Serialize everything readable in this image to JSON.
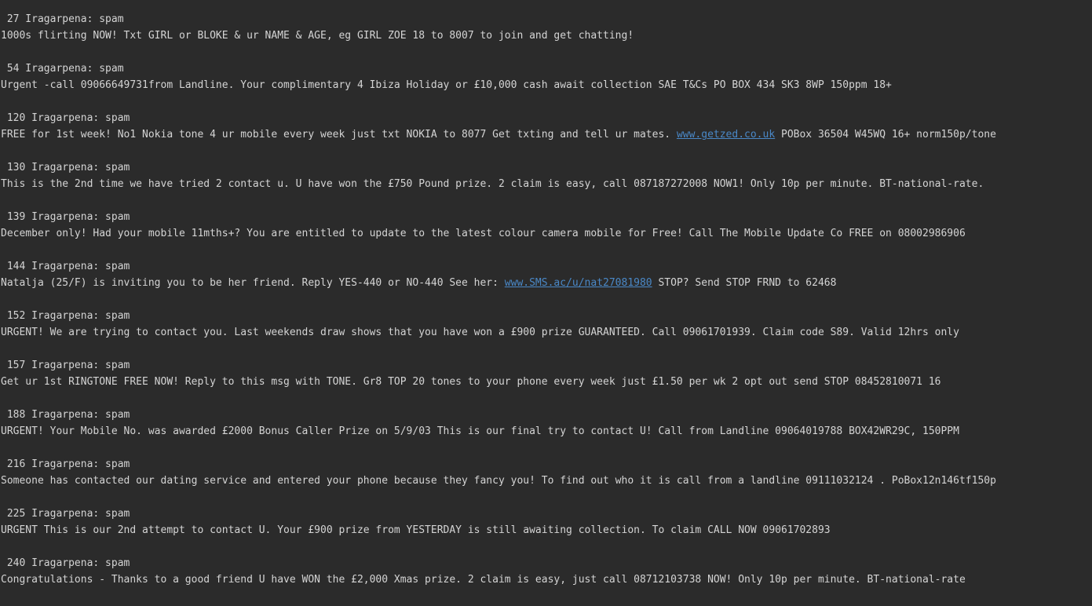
{
  "entries": [
    {
      "header": " 27 Iragarpena: spam",
      "segments": [
        {
          "text": "1000s flirting NOW! Txt GIRL or BLOKE & ur NAME & AGE, eg GIRL ZOE 18 to 8007 to join and get chatting!"
        }
      ]
    },
    {
      "header": " 54 Iragarpena: spam",
      "segments": [
        {
          "text": "Urgent -call 09066649731from Landline. Your complimentary 4 Ibiza Holiday or £10,000 cash await collection SAE T&Cs PO BOX 434 SK3 8WP 150ppm 18+"
        }
      ]
    },
    {
      "header": " 120 Iragarpena: spam",
      "segments": [
        {
          "text": "FREE for 1st week! No1 Nokia tone 4 ur mobile every week just txt NOKIA to 8077 Get txting and tell ur mates. "
        },
        {
          "text": "www.getzed.co.uk",
          "link": true
        },
        {
          "text": " POBox 36504 W45WQ 16+ norm150p/tone"
        }
      ]
    },
    {
      "header": " 130 Iragarpena: spam",
      "segments": [
        {
          "text": "This is the 2nd time we have tried 2 contact u. U have won the £750 Pound prize. 2 claim is easy, call 087187272008 NOW1! Only 10p per minute. BT-national-rate."
        }
      ]
    },
    {
      "header": " 139 Iragarpena: spam",
      "segments": [
        {
          "text": "December only! Had your mobile 11mths+? You are entitled to update to the latest colour camera mobile for Free! Call The Mobile Update Co FREE on 08002986906"
        }
      ]
    },
    {
      "header": " 144 Iragarpena: spam",
      "segments": [
        {
          "text": "Natalja (25/F) is inviting you to be her friend. Reply YES-440 or NO-440 See her: "
        },
        {
          "text": "www.SMS.ac/u/nat27081980",
          "link": true
        },
        {
          "text": " STOP? Send STOP FRND to 62468"
        }
      ]
    },
    {
      "header": " 152 Iragarpena: spam",
      "segments": [
        {
          "text": "URGENT! We are trying to contact you. Last weekends draw shows that you have won a £900 prize GUARANTEED. Call 09061701939. Claim code S89. Valid 12hrs only"
        }
      ]
    },
    {
      "header": " 157 Iragarpena: spam",
      "segments": [
        {
          "text": "Get ur 1st RINGTONE FREE NOW! Reply to this msg with TONE. Gr8 TOP 20 tones to your phone every week just £1.50 per wk 2 opt out send STOP 08452810071 16"
        }
      ]
    },
    {
      "header": " 188 Iragarpena: spam",
      "segments": [
        {
          "text": "URGENT! Your Mobile No. was awarded £2000 Bonus Caller Prize on 5/9/03 This is our final try to contact U! Call from Landline 09064019788 BOX42WR29C, 150PPM"
        }
      ]
    },
    {
      "header": " 216 Iragarpena: spam",
      "segments": [
        {
          "text": "Someone has contacted our dating service and entered your phone because they fancy you! To find out who it is call from a landline 09111032124 . PoBox12n146tf150p"
        }
      ]
    },
    {
      "header": " 225 Iragarpena: spam",
      "segments": [
        {
          "text": "URGENT This is our 2nd attempt to contact U. Your £900 prize from YESTERDAY is still awaiting collection. To claim CALL NOW 09061702893"
        }
      ]
    },
    {
      "header": " 240 Iragarpena: spam",
      "segments": [
        {
          "text": "Congratulations - Thanks to a good friend U have WON the £2,000 Xmas prize. 2 claim is easy, just call 08712103738 NOW! Only 10p per minute. BT-national-rate"
        }
      ]
    }
  ]
}
